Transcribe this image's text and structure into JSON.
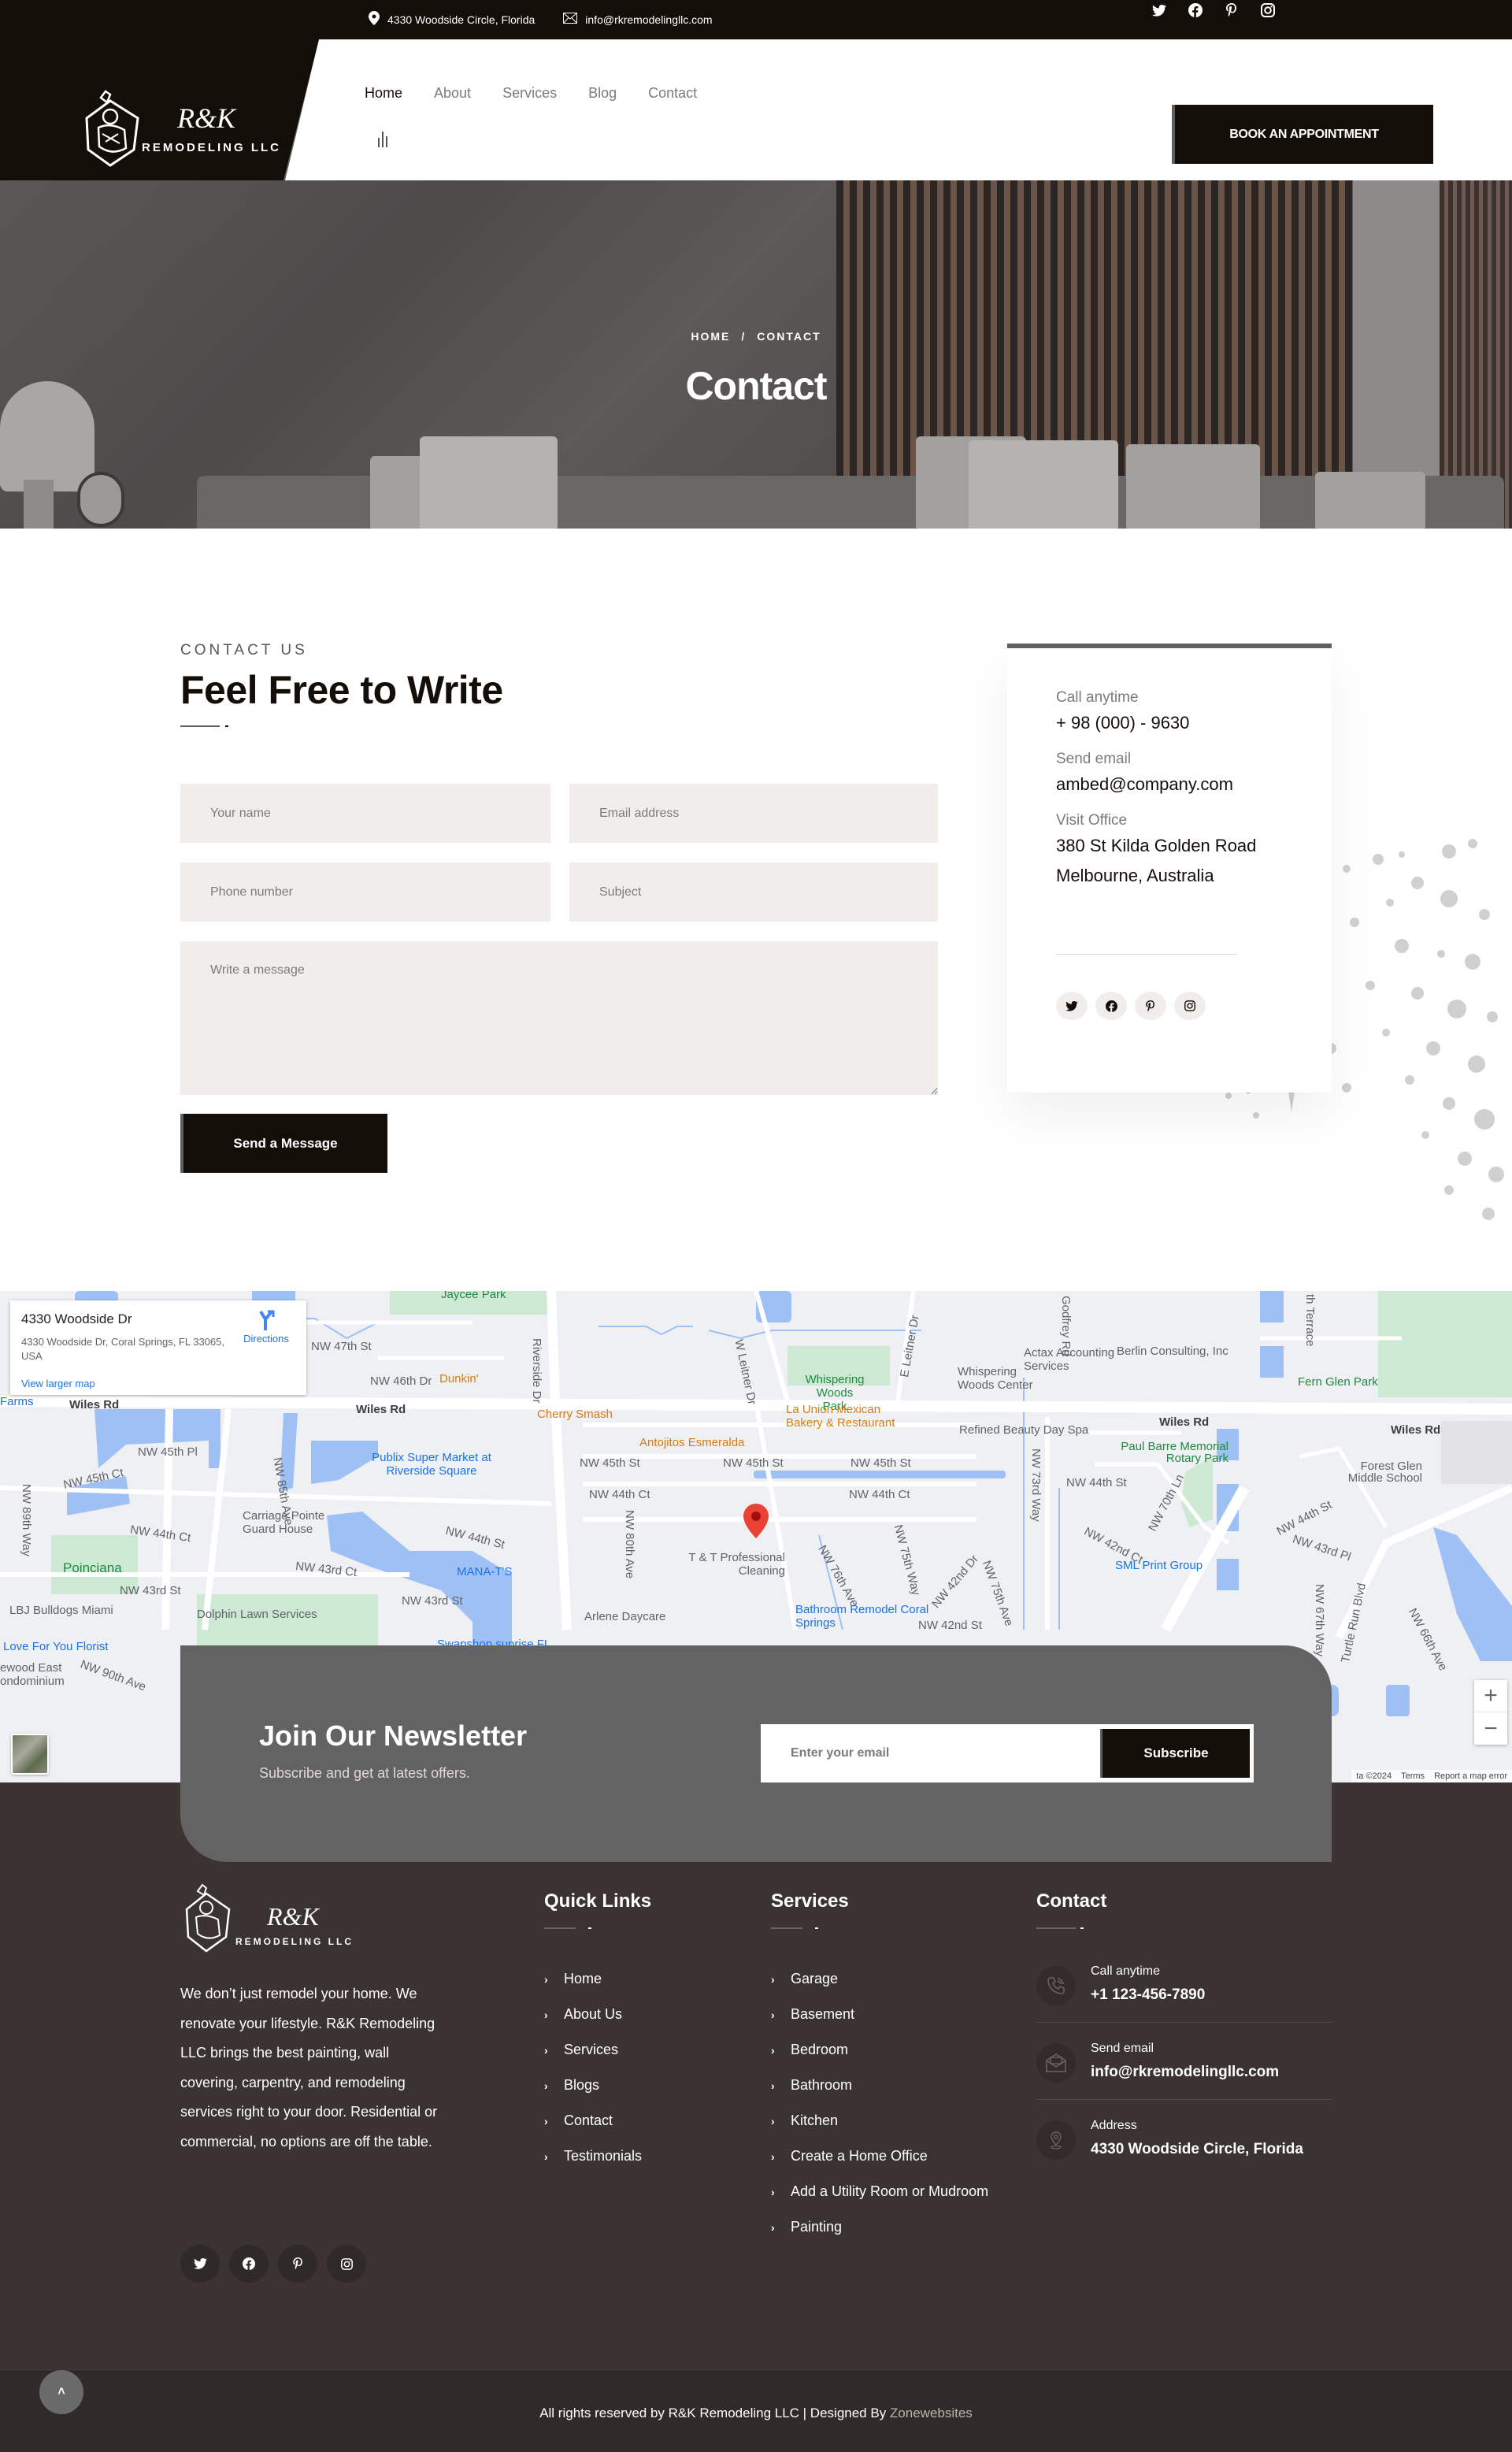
{
  "topbar": {
    "address": "4330 Woodside Circle, Florida",
    "email": "info@rkremodelingllc.com",
    "social": [
      "twitter-icon",
      "facebook-icon",
      "pinterest-icon",
      "instagram-icon"
    ]
  },
  "header": {
    "logo_main": "R&K",
    "logo_sub": "REMODELING LLC",
    "nav": [
      {
        "label": "Home",
        "active": true
      },
      {
        "label": "About",
        "active": false
      },
      {
        "label": "Services",
        "active": false
      },
      {
        "label": "Blog",
        "active": false
      },
      {
        "label": "Contact",
        "active": false
      }
    ],
    "cta_label": "BOOK AN APPOINTMENT"
  },
  "hero": {
    "breadcrumb_home": "HOME",
    "breadcrumb_sep": "/",
    "breadcrumb_current": "CONTACT",
    "title": "Contact"
  },
  "contact_form": {
    "eyebrow": "CONTACT US",
    "title": "Feel Free to Write",
    "name_placeholder": "Your name",
    "email_placeholder": "Email address",
    "phone_placeholder": "Phone number",
    "subject_placeholder": "Subject",
    "message_placeholder": "Write a message",
    "submit_label": "Send a Message"
  },
  "info_card": {
    "call_label": "Call anytime",
    "call_value": "+ 98 (000) - 9630",
    "email_label": "Send email",
    "email_value": "ambed@company.com",
    "office_label": "Visit Office",
    "office_line1": "380 St Kilda Golden Road",
    "office_line2": "Melbourne, Australia",
    "social": [
      "twitter-icon",
      "facebook-icon",
      "pinterest-icon",
      "instagram-icon"
    ]
  },
  "map": {
    "card_title": "4330 Woodside Dr",
    "card_address": "4330 Woodside Dr, Coral Springs, FL 33065, USA",
    "card_directions": "Directions",
    "card_larger": "View larger map",
    "attrib_data": "ta ©2024",
    "attrib_terms": "Terms",
    "attrib_report": "Report a map error",
    "labels": [
      {
        "text": "Jaycee Park",
        "kind": "green"
      },
      {
        "text": "NW 47th St",
        "kind": "grey"
      },
      {
        "text": "NW 46th Dr",
        "kind": "grey"
      },
      {
        "text": "Dunkin'",
        "kind": "orange"
      },
      {
        "text": "Riverside Dr",
        "kind": "grey"
      },
      {
        "text": "Farms",
        "kind": "blue"
      },
      {
        "text": "Wiles Rd",
        "kind": "dark"
      },
      {
        "text": "Wiles Rd",
        "kind": "dark"
      },
      {
        "text": "NW 45th Pl",
        "kind": "grey"
      },
      {
        "text": "NW 45th Ct",
        "kind": "grey"
      },
      {
        "text": "NW 85th Ave",
        "kind": "grey"
      },
      {
        "text": "Publix Super Market at Riverside Square",
        "kind": "blue"
      },
      {
        "text": "NW 89th Way",
        "kind": "grey"
      },
      {
        "text": "NW 44th Ct",
        "kind": "grey"
      },
      {
        "text": "Carriage Pointe Guard House",
        "kind": "grey"
      },
      {
        "text": "NW 44th St",
        "kind": "grey"
      },
      {
        "text": "Poinciana",
        "kind": "green"
      },
      {
        "text": "NW 43rd Ct",
        "kind": "grey"
      },
      {
        "text": "MANA-T'S",
        "kind": "blue"
      },
      {
        "text": "NW 43rd St",
        "kind": "grey"
      },
      {
        "text": "NW 43rd St",
        "kind": "grey"
      },
      {
        "text": "LBJ Bulldogs Miami",
        "kind": "grey"
      },
      {
        "text": "Dolphin Lawn Services",
        "kind": "grey"
      },
      {
        "text": "Love For You Florist",
        "kind": "blue"
      },
      {
        "text": "ewood East ondominium",
        "kind": "grey"
      },
      {
        "text": "NW 90th Ave",
        "kind": "grey"
      },
      {
        "text": "Swapshop suprise FL",
        "kind": "blue"
      },
      {
        "text": "Cherry Smash",
        "kind": "orange"
      },
      {
        "text": "W Leitner Dr",
        "kind": "grey"
      },
      {
        "text": "Whispering Woods Park",
        "kind": "green"
      },
      {
        "text": "E Leitner Dr",
        "kind": "grey"
      },
      {
        "text": "La Union Mexican Bakery & Restaurant",
        "kind": "orange"
      },
      {
        "text": "Antojitos Esmeralda",
        "kind": "orange"
      },
      {
        "text": "NW 45th St",
        "kind": "grey"
      },
      {
        "text": "NW 45th St",
        "kind": "grey"
      },
      {
        "text": "NW 45th St",
        "kind": "grey"
      },
      {
        "text": "NW 44th Ct",
        "kind": "grey"
      },
      {
        "text": "NW 44th Ct",
        "kind": "grey"
      },
      {
        "text": "NW 80th Ave",
        "kind": "grey"
      },
      {
        "text": "T & T Professional Cleaning",
        "kind": "grey"
      },
      {
        "text": "NW 76th Ave",
        "kind": "grey"
      },
      {
        "text": "NW 75th Way",
        "kind": "grey"
      },
      {
        "text": "NW 42nd Dr",
        "kind": "grey"
      },
      {
        "text": "NW 75th Ave",
        "kind": "grey"
      },
      {
        "text": "Bathroom Remodel Coral Springs",
        "kind": "blue"
      },
      {
        "text": "Arlene Daycare",
        "kind": "grey"
      },
      {
        "text": "NW 42nd St",
        "kind": "grey"
      },
      {
        "text": "Actax Accounting Services",
        "kind": "grey"
      },
      {
        "text": "Whispering Woods Center",
        "kind": "grey"
      },
      {
        "text": "Refined Beauty Day Spa",
        "kind": "grey"
      },
      {
        "text": "Godfrey Rd",
        "kind": "grey"
      },
      {
        "text": "Berlin Consulting, Inc",
        "kind": "grey"
      },
      {
        "text": "Fern Glen Park",
        "kind": "green"
      },
      {
        "text": "th Terrace",
        "kind": "grey"
      },
      {
        "text": "Wiles Rd",
        "kind": "dark"
      },
      {
        "text": "Wiles Rd",
        "kind": "dark"
      },
      {
        "text": "Paul Barre Memorial Rotary Park",
        "kind": "green"
      },
      {
        "text": "NW 73rd Way",
        "kind": "grey"
      },
      {
        "text": "NW 44th St",
        "kind": "grey"
      },
      {
        "text": "NW 70th Ln",
        "kind": "grey"
      },
      {
        "text": "Forest Glen Middle School",
        "kind": "grey"
      },
      {
        "text": "NW 42nd Ct",
        "kind": "grey"
      },
      {
        "text": "SML Print Group",
        "kind": "blue"
      },
      {
        "text": "NW 44th St",
        "kind": "grey"
      },
      {
        "text": "NW 43rd Pl",
        "kind": "grey"
      },
      {
        "text": "NW 67th Way",
        "kind": "grey"
      },
      {
        "text": "Turtle Run Blvd",
        "kind": "grey"
      },
      {
        "text": "NW 66th Ave",
        "kind": "grey"
      }
    ]
  },
  "newsletter": {
    "title": "Join Our Newsletter",
    "subtitle": "Subscribe and get at latest offers.",
    "email_placeholder": "Enter your email",
    "button_label": "Subscribe"
  },
  "footer": {
    "about": "We don’t just remodel your home. We renovate your lifestyle. R&K Remodeling LLC brings the best painting, wall covering, carpentry, and remodeling services right to your door. Residential or commercial, no options are off the table.",
    "quick_links_title": "Quick Links",
    "quick_links": [
      "Home",
      "About Us",
      "Services",
      "Blogs",
      "Contact",
      "Testimonials"
    ],
    "services_title": "Services",
    "services": [
      "Garage",
      "Basement",
      "Bedroom",
      "Bathroom",
      "Kitchen",
      "Create a Home Office",
      "Add a Utility Room or Mudroom",
      "Painting"
    ],
    "contact_title": "Contact",
    "contact": [
      {
        "label": "Call anytime",
        "value": "+1 123-456-7890",
        "icon": "phone-icon"
      },
      {
        "label": "Send email",
        "value": "info@rkremodelingllc.com",
        "icon": "envelope-icon"
      },
      {
        "label": "Address",
        "value": "4330 Woodside Circle, Florida",
        "icon": "location-pin-icon"
      }
    ],
    "copyright": "All rights reserved by R&K Remodeling LLC | Designed By ",
    "designer": "Zonewebsites"
  },
  "colors": {
    "primary_dark": "#140e09",
    "accent_grey": "#5f5f5f",
    "field_bg": "#f0edeb",
    "footer_bg": "#3b3331",
    "newsletter_bg": "#636363"
  }
}
